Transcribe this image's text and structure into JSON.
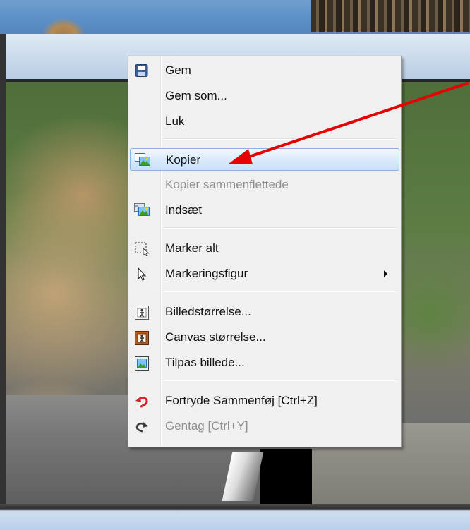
{
  "context_menu": {
    "items": [
      {
        "label": "Gem",
        "icon": "save-icon",
        "enabled": true
      },
      {
        "label": "Gem som...",
        "icon": "",
        "enabled": true
      },
      {
        "label": "Luk",
        "icon": "",
        "enabled": true
      },
      {
        "label": "Kopier",
        "icon": "copy-image-icon",
        "enabled": true,
        "selected": true
      },
      {
        "label": "Kopier sammenflettede",
        "icon": "",
        "enabled": false
      },
      {
        "label": "Indsæt",
        "icon": "paste-image-icon",
        "enabled": true
      },
      {
        "label": "Marker alt",
        "icon": "select-all-icon",
        "enabled": true
      },
      {
        "label": "Markeringsfigur",
        "icon": "selection-cursor-icon",
        "enabled": true,
        "has_submenu": true
      },
      {
        "label": "Billedstørrelse...",
        "icon": "image-size-icon",
        "enabled": true
      },
      {
        "label": "Canvas størrelse...",
        "icon": "canvas-size-icon",
        "enabled": true
      },
      {
        "label": "Tilpas billede...",
        "icon": "fit-image-icon",
        "enabled": true
      },
      {
        "label": "Fortryde Sammenføj [Ctrl+Z]",
        "icon": "undo-icon",
        "enabled": true
      },
      {
        "label": "Gentag [Ctrl+Y]",
        "icon": "redo-icon",
        "enabled": false
      }
    ]
  },
  "colors": {
    "menu_background": "#f0f0f0",
    "selection_border": "#8ab4e4",
    "annotation_arrow": "#e60000",
    "undo_icon": "#d8202b"
  }
}
